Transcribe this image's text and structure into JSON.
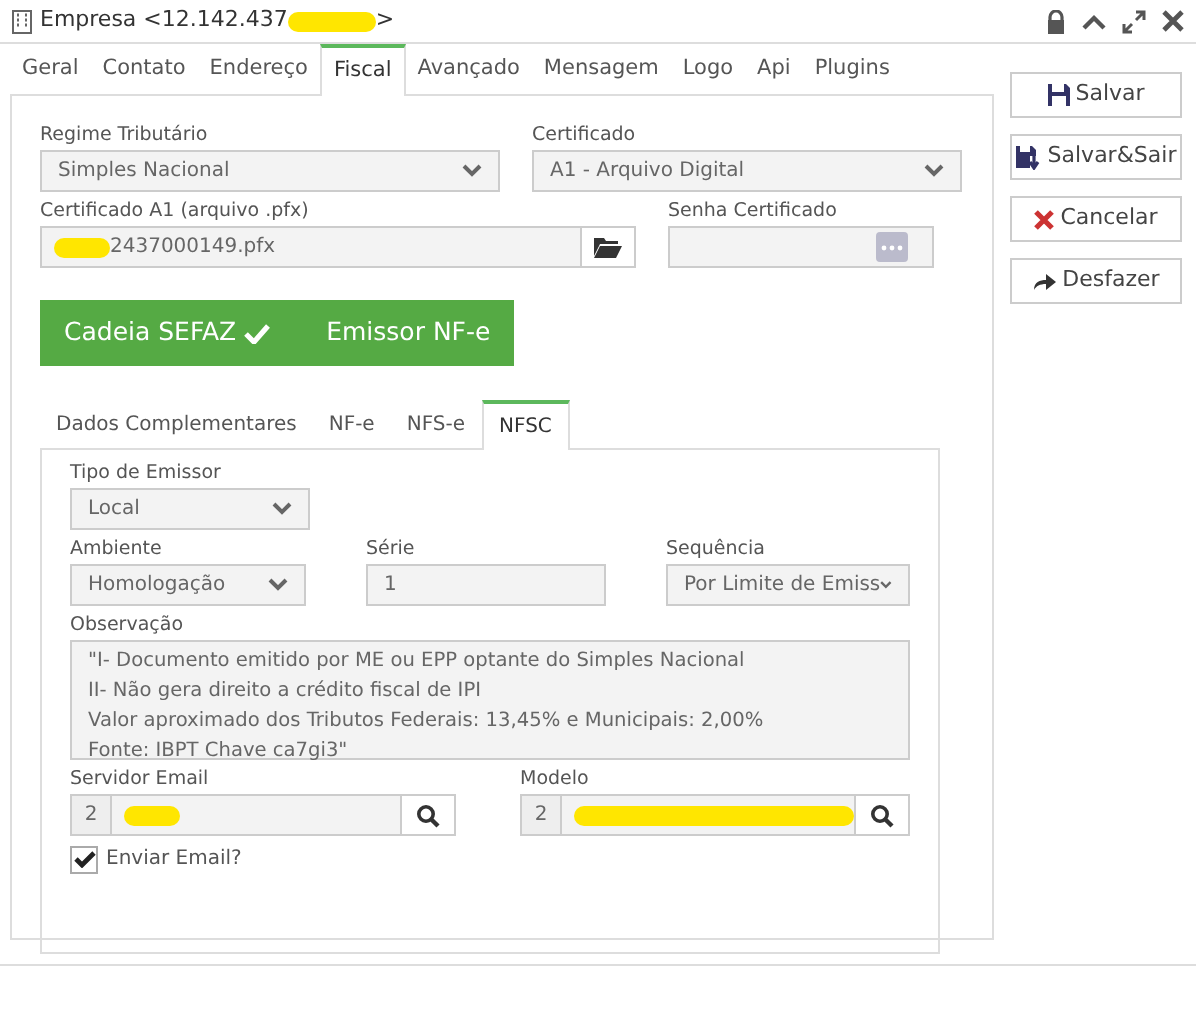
{
  "window": {
    "title": "Empresa <12.142.437",
    "title_end": ">",
    "redacted": true
  },
  "tabs": [
    {
      "label": "Geral",
      "selected": false
    },
    {
      "label": "Contato",
      "selected": false
    },
    {
      "label": "Endereço",
      "selected": false
    },
    {
      "label": "Fiscal",
      "selected": true
    },
    {
      "label": "Avançado",
      "selected": false
    },
    {
      "label": "Mensagem",
      "selected": false
    },
    {
      "label": "Logo",
      "selected": false
    },
    {
      "label": "Api",
      "selected": false
    },
    {
      "label": "Plugins",
      "selected": false
    }
  ],
  "regime": {
    "label": "Regime Tributário",
    "value": "Simples Nacional"
  },
  "certificado": {
    "label": "Certificado",
    "value": "A1 - Arquivo Digital"
  },
  "arquivo": {
    "label": "Certificado A1 (arquivo .pfx)",
    "value": "2437000149.pfx",
    "redacted": true
  },
  "senha": {
    "label": "Senha Certificado"
  },
  "status_buttons": [
    {
      "label": "Cadeia SEFAZ",
      "checked": true
    },
    {
      "label": "Emissor NF-e",
      "checked": false
    }
  ],
  "subtabs": [
    {
      "label": "Dados Complementares",
      "selected": false
    },
    {
      "label": "NF-e",
      "selected": false
    },
    {
      "label": "NFS-e",
      "selected": false
    },
    {
      "label": "NFSC",
      "selected": true
    }
  ],
  "tipo_emissor": {
    "label": "Tipo de Emissor",
    "value": "Local"
  },
  "ambiente": {
    "label": "Ambiente",
    "value": "Homologação"
  },
  "serie": {
    "label": "Série",
    "value": "1"
  },
  "sequencia": {
    "label": "Sequência",
    "value": "Por Limite de Emiss"
  },
  "observacao": {
    "label": "Observação",
    "lines": [
      "\"I- Documento emitido por ME ou EPP optante do Simples Nacional",
      "II- Não gera direito a crédito fiscal de IPI",
      "Valor aproximado dos Tributos Federais: 13,45% e Municipais: 2,00%",
      "Fonte: IBPT Chave ca7gi3\""
    ]
  },
  "lookups": [
    {
      "label": "Servidor Email",
      "code": "2",
      "redacted": true
    },
    {
      "label": "Modelo",
      "code": "2",
      "redacted": true
    }
  ],
  "enviar_email": {
    "label": "Enviar Email?",
    "checked": true
  },
  "actions": [
    {
      "label": "Salvar",
      "kind": "save"
    },
    {
      "label": "Salvar&Sair",
      "kind": "save-exit"
    },
    {
      "label": "Cancelar",
      "kind": "cancel"
    },
    {
      "label": "Desfazer",
      "kind": "undo"
    }
  ]
}
